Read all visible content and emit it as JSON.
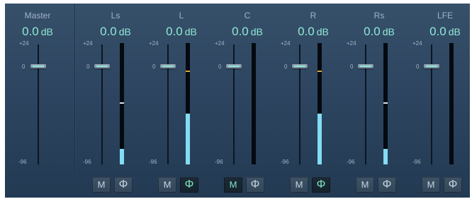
{
  "mixer": {
    "channels": [
      {
        "name": "Master",
        "gain_value": "0.0",
        "gain_unit": "dB",
        "scale_top": "+24",
        "scale_zero": "0",
        "scale_bottom": "-96"
      },
      {
        "name": "Ls",
        "gain_value": "0.0",
        "gain_unit": "dB",
        "scale_top": "+24",
        "scale_zero": "0",
        "scale_bottom": "-96",
        "meter_level": 0.13,
        "peak_level": 0.5,
        "peak_color": "#d8e4ee",
        "mute_label": "M",
        "mute_active": false,
        "phase_label": "Φ",
        "phase_active": false
      },
      {
        "name": "L",
        "gain_value": "0.0",
        "gain_unit": "dB",
        "scale_top": "+24",
        "scale_zero": "0",
        "scale_bottom": "-96",
        "meter_level": 0.42,
        "peak_level": 0.76,
        "peak_color": "#e0a63a",
        "mute_label": "M",
        "mute_active": false,
        "phase_label": "Φ",
        "phase_active": true
      },
      {
        "name": "C",
        "gain_value": "0.0",
        "gain_unit": "dB",
        "scale_top": "+24",
        "scale_zero": "0",
        "scale_bottom": "-96",
        "meter_level": 0.0,
        "peak_level": null,
        "peak_color": "#d8e4ee",
        "mute_label": "M",
        "mute_active": true,
        "phase_label": "Φ",
        "phase_active": false
      },
      {
        "name": "R",
        "gain_value": "0.0",
        "gain_unit": "dB",
        "scale_top": "+24",
        "scale_zero": "0",
        "scale_bottom": "-96",
        "meter_level": 0.42,
        "peak_level": 0.76,
        "peak_color": "#e0a63a",
        "mute_label": "M",
        "mute_active": false,
        "phase_label": "Φ",
        "phase_active": true
      },
      {
        "name": "Rs",
        "gain_value": "0.0",
        "gain_unit": "dB",
        "scale_top": "+24",
        "scale_zero": "0",
        "scale_bottom": "-96",
        "meter_level": 0.13,
        "peak_level": 0.5,
        "peak_color": "#d8e4ee",
        "mute_label": "M",
        "mute_active": false,
        "phase_label": "Φ",
        "phase_active": false
      },
      {
        "name": "LFE",
        "gain_value": "0.0",
        "gain_unit": "dB",
        "scale_top": "+24",
        "scale_zero": "0",
        "scale_bottom": "-96",
        "meter_level": 0.0,
        "peak_level": null,
        "peak_color": "#d8e4ee",
        "mute_label": "M",
        "mute_active": false,
        "phase_label": "Φ",
        "phase_active": false
      }
    ]
  },
  "colors": {
    "value_text": "#8fe7d4",
    "meter_fill": "#83dcf3",
    "active_button_text": "#7fe3c2"
  },
  "icons": {
    "phase": "phase-invert-icon",
    "fader": "fader-handle-icon"
  }
}
